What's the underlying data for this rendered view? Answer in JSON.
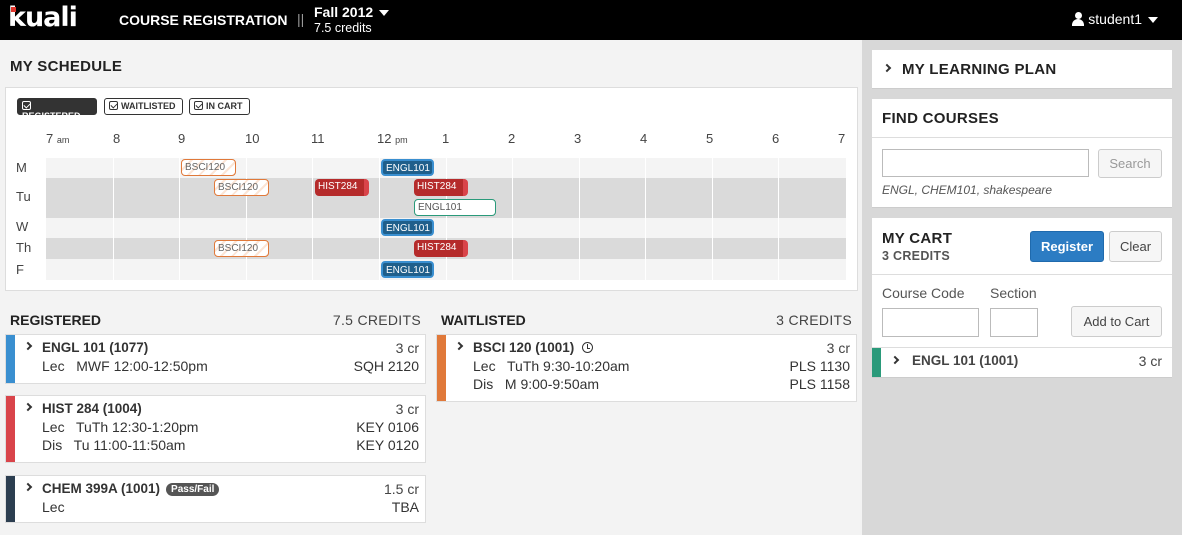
{
  "header": {
    "logo": "kuali",
    "app_title": "COURSE REGISTRATION",
    "separator": "||",
    "term": "Fall 2012",
    "term_credits": "7.5 credits",
    "user": "student1"
  },
  "schedule": {
    "title": "MY SCHEDULE",
    "legend": [
      "REGISTERED",
      "WAITLISTED",
      "IN CART"
    ],
    "hours": [
      "7",
      "8",
      "9",
      "10",
      "11",
      "12",
      "1",
      "2",
      "3",
      "4",
      "5",
      "6",
      "7"
    ],
    "hour_suffix_am": "am",
    "hour_suffix_pm": "pm",
    "days": [
      "M",
      "Tu",
      "W",
      "Th",
      "F"
    ],
    "events": {
      "m_bsci": "BSCI120",
      "m_engl": "ENGL101",
      "tu_bsci": "BSCI120",
      "tu_hist_a": "HIST284",
      "tu_hist_b": "HIST284",
      "tu_engl_cart": "ENGL101",
      "w_engl": "ENGL101",
      "th_bsci": "BSCI120",
      "th_hist": "HIST284",
      "f_engl": "ENGL101"
    }
  },
  "registered": {
    "title": "REGISTERED",
    "credits": "7.5 CREDITS",
    "courses": [
      {
        "code": "ENGL 101 (1077)",
        "credits": "3 cr",
        "lines": [
          {
            "type": "Lec",
            "time": "MWF 12:00-12:50pm",
            "loc": "SQH 2120"
          }
        ]
      },
      {
        "code": "HIST 284 (1004)",
        "credits": "3 cr",
        "lines": [
          {
            "type": "Lec",
            "time": "TuTh 12:30-1:20pm",
            "loc": "KEY 0106"
          },
          {
            "type": "Dis",
            "time": "Tu 11:00-11:50am",
            "loc": "KEY 0120"
          }
        ]
      },
      {
        "code": "CHEM 399A (1001)",
        "badge": "Pass/Fail",
        "credits": "1.5 cr",
        "lines": [
          {
            "type": "Lec",
            "time": "",
            "loc": "TBA"
          }
        ]
      }
    ]
  },
  "waitlisted": {
    "title": "WAITLISTED",
    "credits": "3 CREDITS",
    "courses": [
      {
        "code": "BSCI 120 (1001)",
        "credits": "3 cr",
        "lines": [
          {
            "type": "Lec",
            "time": "TuTh 9:30-10:20am",
            "loc": "PLS 1130"
          },
          {
            "type": "Dis",
            "time": "M 9:00-9:50am",
            "loc": "PLS 1158"
          }
        ]
      }
    ]
  },
  "learning_plan": {
    "title": "MY LEARNING PLAN"
  },
  "find_courses": {
    "title": "FIND COURSES",
    "search_value": "",
    "search_button": "Search",
    "hint": "ENGL, CHEM101, shakespeare"
  },
  "cart": {
    "title": "MY CART",
    "credits": "3 CREDITS",
    "register_button": "Register",
    "clear_button": "Clear",
    "course_code_label": "Course Code",
    "section_label": "Section",
    "add_button": "Add to Cart",
    "items": [
      {
        "code": "ENGL 101 (1001)",
        "credits": "3 cr"
      }
    ]
  },
  "colors": {
    "engl": "#1f5f8b",
    "hist": "#b52b2b",
    "chem": "#2c3e50",
    "bsci": "#e0793a",
    "cart": "#2a9a7a",
    "engl_bar": "#3a8fd0",
    "hist_bar": "#d9444a"
  }
}
